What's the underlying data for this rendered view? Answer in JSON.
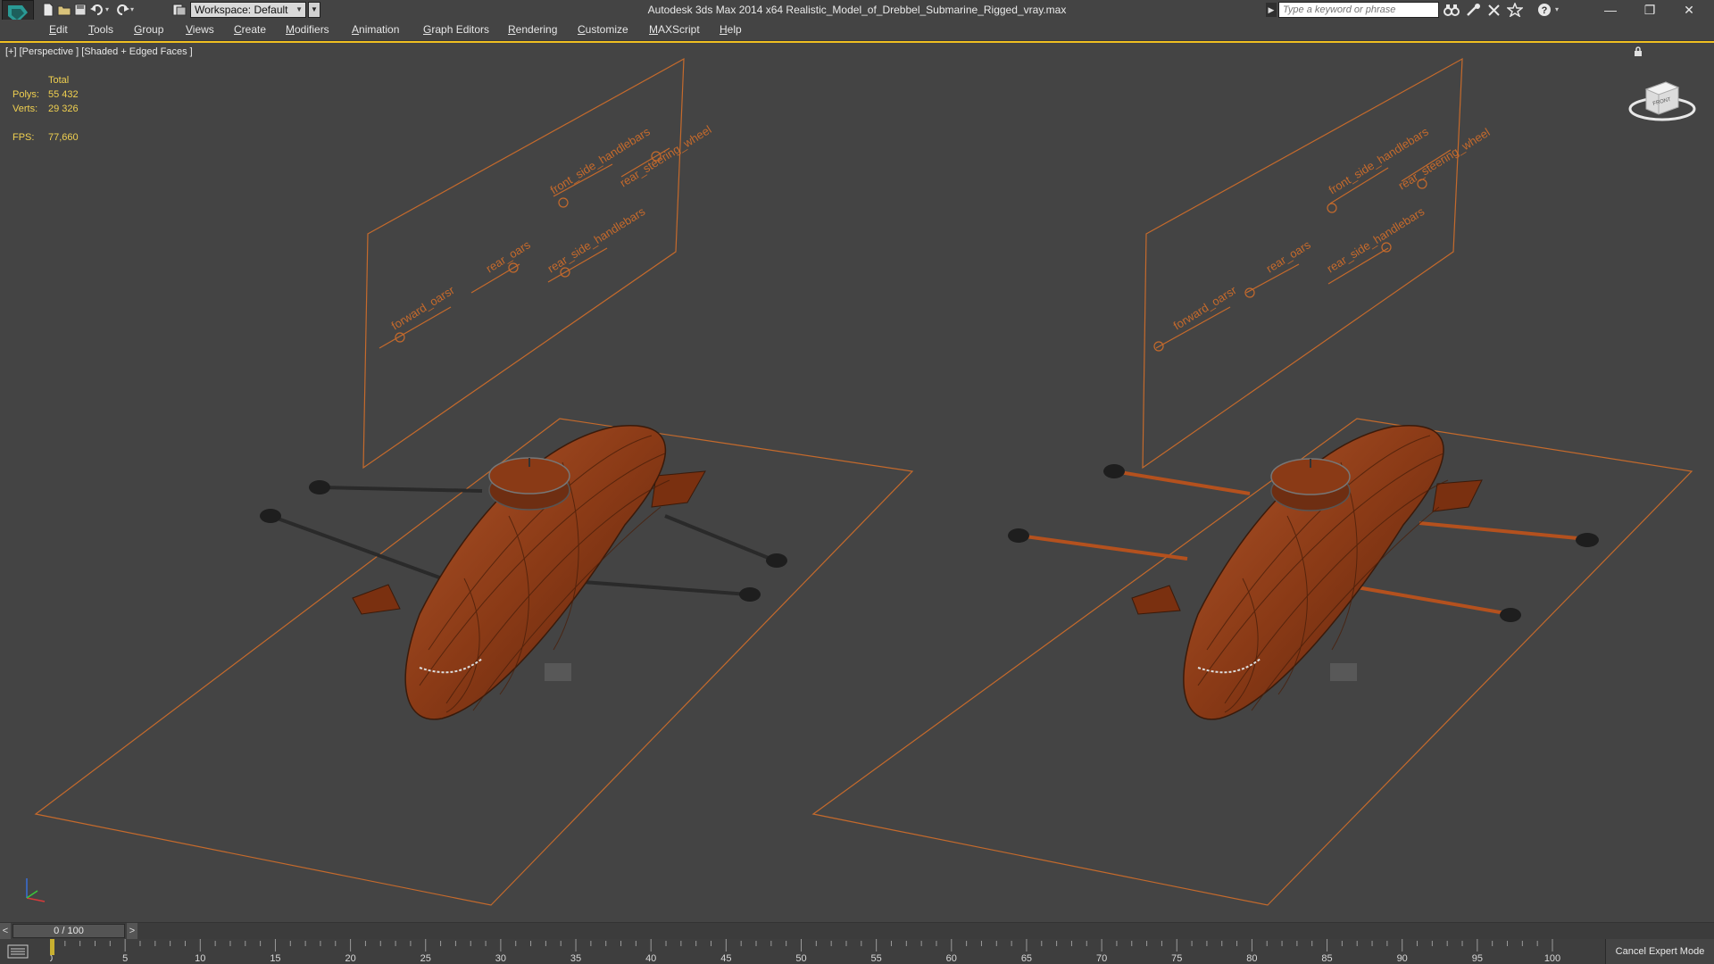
{
  "titlebar": {
    "workspace_label": "Workspace: Default",
    "app_name": "Autodesk 3ds Max  2014 x64",
    "file_name": "Realistic_Model_of_Drebbel_Submarine_Rigged_vray.max",
    "window_title": "Autodesk 3ds Max  2014 x64      Realistic_Model_of_Drebbel_Submarine_Rigged_vray.max",
    "search_placeholder": "Type a keyword or phrase",
    "quick_access_icons": [
      "new-file-icon",
      "open-file-icon",
      "save-icon",
      "undo-icon",
      "redo-icon",
      "project-folder-icon"
    ],
    "toolbar_icons": [
      "binoculars-icon",
      "communication-center-icon",
      "subscription-icon",
      "favorites-star-icon",
      "help-icon"
    ],
    "window_buttons": [
      "minimize",
      "restore",
      "close"
    ]
  },
  "menubar": {
    "items": [
      "Edit",
      "Tools",
      "Group",
      "Views",
      "Create",
      "Modifiers",
      "Animation",
      "Graph Editors",
      "Rendering",
      "Customize",
      "MAXScript",
      "Help"
    ]
  },
  "viewport": {
    "label": "[+] [Perspective ] [Shaded + Edged Faces ]",
    "stats": {
      "header": "Total",
      "polys_label": "Polys:",
      "polys_value": "55 432",
      "verts_label": "Verts:",
      "verts_value": "29 326",
      "fps_label": "FPS:",
      "fps_value": "77,660"
    },
    "viewcube_face": "FRONT",
    "rig_labels": [
      "forward_oarsr",
      "rear_oars",
      "front_side_handlebars",
      "rear_side_handlebars",
      "rear_steering_wheel"
    ],
    "colors": {
      "wireframe": "#c56a2c",
      "hull": "#8a3a16",
      "background": "#444444",
      "stats_text": "#f0d050",
      "active_border": "#f0c020"
    }
  },
  "timeline": {
    "frame_display": "0 / 100",
    "prev_label": "<",
    "next_label": ">",
    "ticks": [
      0,
      5,
      10,
      15,
      20,
      25,
      30,
      35,
      40,
      45,
      50,
      55,
      60,
      65,
      70,
      75,
      80,
      85,
      90,
      95,
      100
    ],
    "current_frame": 0
  },
  "statusbar": {
    "cancel_expert_label": "Cancel Expert Mode"
  }
}
